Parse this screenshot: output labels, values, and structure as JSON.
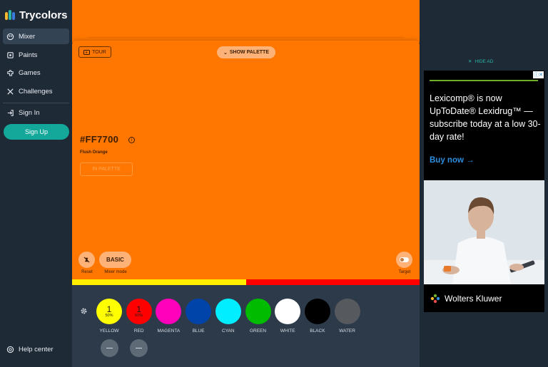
{
  "app": {
    "name": "Trycolors"
  },
  "sidebar": {
    "items": [
      {
        "label": "Mixer",
        "icon": "mixer-icon",
        "active": true
      },
      {
        "label": "Paints",
        "icon": "paints-icon"
      },
      {
        "label": "Games",
        "icon": "games-icon"
      },
      {
        "label": "Challenges",
        "icon": "challenges-icon"
      }
    ],
    "sign_in": "Sign In",
    "sign_up": "Sign Up",
    "help": "Help center"
  },
  "mixer": {
    "tour_label": "TOUR",
    "show_palette_label": "SHOW PALETTE",
    "hex": "#FF7700",
    "color_name": "Flush Orange",
    "in_palette_label": "IN PALETTE",
    "reset_label": "Reset",
    "mode_button": "BASIC",
    "mode_label": "Mixer mode",
    "target_label": "Target",
    "background": "#FF7700",
    "ratio": [
      {
        "color": "#FFEE00",
        "fraction": 0.5
      },
      {
        "color": "#FF0000",
        "fraction": 0.5
      }
    ]
  },
  "paints": [
    {
      "label": "YELLOW",
      "color": "#FFFF00",
      "count": "1",
      "percent": "50%"
    },
    {
      "label": "RED",
      "color": "#FF0000",
      "count": "1",
      "percent": "50%"
    },
    {
      "label": "MAGENTA",
      "color": "#FF00BB",
      "count": "",
      "percent": ""
    },
    {
      "label": "BLUE",
      "color": "#0044AA",
      "count": "",
      "percent": ""
    },
    {
      "label": "CYAN",
      "color": "#00EEFF",
      "count": "",
      "percent": ""
    },
    {
      "label": "GREEN",
      "color": "#00BB00",
      "count": "",
      "percent": ""
    },
    {
      "label": "WHITE",
      "color": "#FFFFFF",
      "count": "",
      "percent": ""
    },
    {
      "label": "BLACK",
      "color": "#000000",
      "count": "",
      "percent": ""
    },
    {
      "label": "WATER",
      "color": "#56595E",
      "count": "",
      "percent": ""
    }
  ],
  "ad": {
    "hide_label": "HIDE AD",
    "close_glyph": "ⓘ✕",
    "headline": "Lexicomp® is now UpToDate® Lexidrug™ — subscribe today at a low 30-day rate!",
    "cta": "Buy now →",
    "brand": "Wolters Kluwer"
  }
}
